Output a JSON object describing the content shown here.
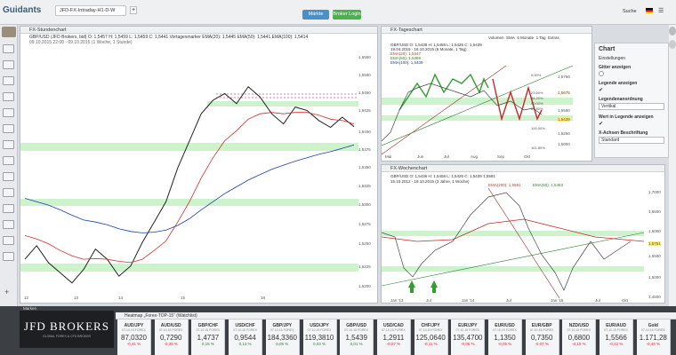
{
  "app": {
    "logo": "Guidants",
    "tabs": [
      "JFD-FX-Intraday-H1-D-W"
    ],
    "search_label": "Suche",
    "market_btn": "Märkte",
    "login_btn": "Broker Login"
  },
  "left_chart": {
    "title": "FX-Stundenchart",
    "legend": [
      "GBP/USD (JFD Brokers, bid)  O: 1,5457  H: 1,5459  L: 1,5459  C: 1,5441  Vortagesmarker  EMA(20): 1,5445  EMA(50): 1,5441  EMA(100): 1,5414",
      "09.10.2015 22:00 - 09.10.2015 (1 Woche, 1 Stunde)"
    ],
    "y_ticks": [
      "1,5550",
      "1,5500",
      "1,5450",
      "1,5425",
      "1,5400",
      "1,5375",
      "1,5350",
      "1,5325",
      "1,5300",
      "1,5275",
      "1,5250",
      "1,5225",
      "1,5200"
    ],
    "x_ticks": [
      "12",
      "13",
      "14",
      "15",
      "16"
    ],
    "colors": {
      "ema20": "#d32f2f",
      "ema50": "#2e7d32",
      "ema100": "#1a3faa",
      "zone": "#8ee58e"
    },
    "chart_data": {
      "type": "line",
      "title": "",
      "xlabel": "",
      "ylabel": "",
      "ylim": [
        1.519,
        1.556
      ],
      "series": [
        {
          "name": "GBP/USD",
          "values": [
            1.5245,
            1.5265,
            1.524,
            1.5225,
            1.521,
            1.523,
            1.526,
            1.5245,
            1.522,
            1.5235,
            1.527,
            1.53,
            1.533,
            1.538,
            1.542,
            1.546,
            1.548,
            1.549,
            1.5475,
            1.55,
            1.5485,
            1.546,
            1.5445,
            1.547,
            1.5465,
            1.545,
            1.544,
            1.5455,
            1.5441
          ]
        },
        {
          "name": "EMA(20)",
          "values": [
            1.528,
            1.5275,
            1.5268,
            1.5258,
            1.525,
            1.5245,
            1.5246,
            1.5245,
            1.5242,
            1.524,
            1.5245,
            1.5258,
            1.5272,
            1.53,
            1.533,
            1.5365,
            1.5395,
            1.542,
            1.5435,
            1.5452,
            1.546,
            1.5462,
            1.546,
            1.5462,
            1.5462,
            1.5458,
            1.5452,
            1.545,
            1.5445
          ]
        },
        {
          "name": "EMA(100)",
          "values": [
            1.5335,
            1.533,
            1.5325,
            1.5318,
            1.531,
            1.5303,
            1.53,
            1.5296,
            1.529,
            1.5286,
            1.5284,
            1.5285,
            1.5288,
            1.5295,
            1.5305,
            1.5318,
            1.533,
            1.5342,
            1.5352,
            1.5362,
            1.537,
            1.5378,
            1.5384,
            1.539,
            1.5395,
            1.54,
            1.5404,
            1.5409,
            1.5414
          ]
        }
      ]
    }
  },
  "daily_chart": {
    "title": "FX-Tageschart",
    "toolbar": [
      "Volumen",
      "SMA",
      "6 Monate",
      "1 Tag",
      "Extras"
    ],
    "legend": [
      "GBP/USD  O: 1,5438  H: 1,5458  L: 1,5426  C: 1,5439",
      "19.04.2015 - 19.10.2015 (6 Monate, 1 Tag)",
      "EMA(20): 1,5347",
      "EMA(50): 1,5369",
      "EMA(100): 1,5409"
    ],
    "y_ticks": [
      "1,5750",
      "1,5675",
      "1,5500",
      "1,5439",
      "1,5250",
      "1,5000"
    ],
    "fib_labels": [
      "0,00%",
      "23,60%",
      "38,20%",
      "50,00%",
      "61,80%",
      "100,00%",
      "161,80%"
    ],
    "x_ticks": [
      "Mai",
      "Jun",
      "Jul",
      "Aug",
      "Sep",
      "Okt"
    ]
  },
  "weekly_chart": {
    "title": "FX-Wochenchart",
    "legend": [
      "GBP/USD  O: 1,5436  H: 1,5458  L: 1,5426  C: 1,5439  1,5581",
      "15.10.2012 - 19.10.2015 (3 Jahre, 1 Woche)",
      "EMA(200): 1,5581",
      "EMA(50): 1,5483"
    ],
    "y_ticks": [
      "1,7000",
      "1,6500",
      "1,6000",
      "1,5751",
      "1,5500",
      "1,5000",
      "1,4500"
    ],
    "x_ticks": [
      "Jan '13",
      "Jul",
      "Jan '14",
      "Jul",
      "Jan '15",
      "Jul",
      "Okt"
    ]
  },
  "settings": {
    "title": "Chart",
    "items": [
      "Einstellungen",
      "Gitter anzeigen",
      "Legende anzeigen",
      "Legendenanordnung",
      "Wert in Legende anzeigen",
      "X-Achsen Beschriftung"
    ],
    "legend_mode": "Vertikal",
    "x_axis": "Standard"
  },
  "bottom": {
    "watchlist_title": "Heatmap „Forex-TOP-15“ (Watchlist)",
    "widget_title": "Marken",
    "brand": "JFD BROKERS",
    "brand_sub": "GLOBAL FOREX & CFD BROKER",
    "tiles": [
      {
        "sym": "AUD/JPY",
        "sub": "07.10.15 FOREX",
        "val": "87,0320",
        "chg": "-0,41 %",
        "dir": "neg"
      },
      {
        "sym": "AUD/USD",
        "sub": "07.10.15 FOREX",
        "val": "0,7290",
        "chg": "-0,39 %",
        "dir": "neg"
      },
      {
        "sym": "GBP/CHF",
        "sub": "07.10.15 FOREX",
        "val": "1,4737",
        "chg": "0,15 %",
        "dir": "pos"
      },
      {
        "sym": "USD/CHF",
        "sub": "07.10.15 FOREX",
        "val": "0,9544",
        "chg": "0,13 %",
        "dir": "pos"
      },
      {
        "sym": "GBP/JPY",
        "sub": "07.10.15 FOREX",
        "val": "184,3360",
        "chg": "0,05 %",
        "dir": "pos"
      },
      {
        "sym": "USD/JPY",
        "sub": "07.10.15 FOREX",
        "val": "119,3810",
        "chg": "0,03 %",
        "dir": "pos"
      },
      {
        "sym": "GBP/USD",
        "sub": "07.10.15 FOREX",
        "val": "1,5439",
        "chg": "0,01 %",
        "dir": "pos"
      },
      {
        "sym": "USD/CAD",
        "sub": "07.10.15 FOREX",
        "val": "1,2911",
        "chg": "-0,07 %",
        "dir": "neg"
      },
      {
        "sym": "CHF/JPY",
        "sub": "07.10.15 FOREX",
        "val": "125,0640",
        "chg": "-0,11 %",
        "dir": "neg"
      },
      {
        "sym": "EUR/JPY",
        "sub": "07.10.15 FOREX",
        "val": "135,4700",
        "chg": "-0,06 %",
        "dir": "neg"
      },
      {
        "sym": "EUR/USD",
        "sub": "07.10.15 FOREX",
        "val": "1,1350",
        "chg": "-0,05 %",
        "dir": "neg"
      },
      {
        "sym": "EUR/GBP",
        "sub": "07.10.15 FOREX",
        "val": "0,7350",
        "chg": "-0,07 %",
        "dir": "neg"
      },
      {
        "sym": "NZD/USD",
        "sub": "07.10.15 FOREX",
        "val": "0,6800",
        "chg": "-0,15 %",
        "dir": "neg"
      },
      {
        "sym": "EUR/AUD",
        "sub": "07.10.15 FOREX",
        "val": "1,5566",
        "chg": "-0,42 %",
        "dir": "neg"
      },
      {
        "sym": "Gold",
        "sub": "07.10.15 FOREX",
        "val": "1.171,28",
        "chg": "-0,49 %",
        "dir": "neg"
      }
    ]
  }
}
